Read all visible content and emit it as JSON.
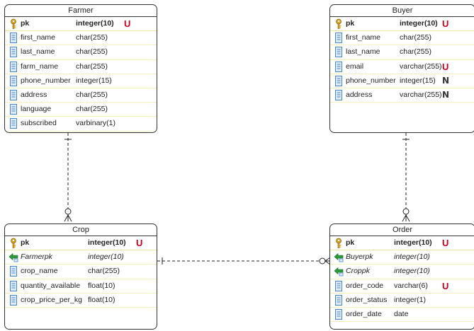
{
  "entities": [
    {
      "id": "farmer",
      "title": "Farmer",
      "columns": [
        {
          "name": "pk",
          "type": "integer(10)",
          "key": "pk",
          "constraint": "U"
        },
        {
          "name": "first_name",
          "type": "char(255)",
          "key": "col",
          "constraint": ""
        },
        {
          "name": "last_name",
          "type": "char(255)",
          "key": "col",
          "constraint": ""
        },
        {
          "name": "farm_name",
          "type": "char(255)",
          "key": "col",
          "constraint": ""
        },
        {
          "name": "phone_number",
          "type": "integer(15)",
          "key": "col",
          "constraint": ""
        },
        {
          "name": "address",
          "type": "char(255)",
          "key": "col",
          "constraint": ""
        },
        {
          "name": "language",
          "type": "char(255)",
          "key": "col",
          "constraint": ""
        },
        {
          "name": "subscribed",
          "type": "varbinary(1)",
          "key": "col",
          "constraint": ""
        }
      ]
    },
    {
      "id": "buyer",
      "title": "Buyer",
      "columns": [
        {
          "name": "pk",
          "type": "integer(10)",
          "key": "pk",
          "constraint": "U"
        },
        {
          "name": "first_name",
          "type": "char(255)",
          "key": "col",
          "constraint": ""
        },
        {
          "name": "last_name",
          "type": "char(255)",
          "key": "col",
          "constraint": ""
        },
        {
          "name": "email",
          "type": "varchar(255)",
          "key": "col",
          "constraint": "U"
        },
        {
          "name": "phone_number",
          "type": "integer(15)",
          "key": "col",
          "constraint": "N"
        },
        {
          "name": "address",
          "type": "varchar(255)",
          "key": "col",
          "constraint": "N"
        }
      ]
    },
    {
      "id": "crop",
      "title": "Crop",
      "columns": [
        {
          "name": "pk",
          "type": "integer(10)",
          "key": "pk",
          "constraint": "U"
        },
        {
          "name": "Farmerpk",
          "type": "integer(10)",
          "key": "fk",
          "constraint": ""
        },
        {
          "name": "crop_name",
          "type": "char(255)",
          "key": "col",
          "constraint": ""
        },
        {
          "name": "quantity_available",
          "type": "float(10)",
          "key": "col",
          "constraint": ""
        },
        {
          "name": "crop_price_per_kg",
          "type": "float(10)",
          "key": "col",
          "constraint": ""
        }
      ]
    },
    {
      "id": "order",
      "title": "Order",
      "columns": [
        {
          "name": "pk",
          "type": "integer(10)",
          "key": "pk",
          "constraint": "U"
        },
        {
          "name": "Buyerpk",
          "type": "integer(10)",
          "key": "fk",
          "constraint": ""
        },
        {
          "name": "Croppk",
          "type": "integer(10)",
          "key": "fk",
          "constraint": ""
        },
        {
          "name": "order_code",
          "type": "varchar(6)",
          "key": "col",
          "constraint": "U"
        },
        {
          "name": "order_status",
          "type": "integer(1)",
          "key": "col",
          "constraint": ""
        },
        {
          "name": "order_date",
          "type": "date",
          "key": "col",
          "constraint": ""
        }
      ]
    }
  ],
  "relationships": [
    {
      "from": "farmer",
      "to": "crop",
      "from_cardinality": "one",
      "to_cardinality": "zero-or-many"
    },
    {
      "from": "buyer",
      "to": "order",
      "from_cardinality": "one",
      "to_cardinality": "zero-or-many"
    },
    {
      "from": "crop",
      "to": "order",
      "from_cardinality": "one",
      "to_cardinality": "zero-or-many"
    }
  ],
  "colors": {
    "border": "#333333",
    "unique_marker": "#c8001e",
    "key_icon": "#d9a521",
    "column_icon": "#4a86c5",
    "fk_arrow": "#2a9a3a"
  }
}
